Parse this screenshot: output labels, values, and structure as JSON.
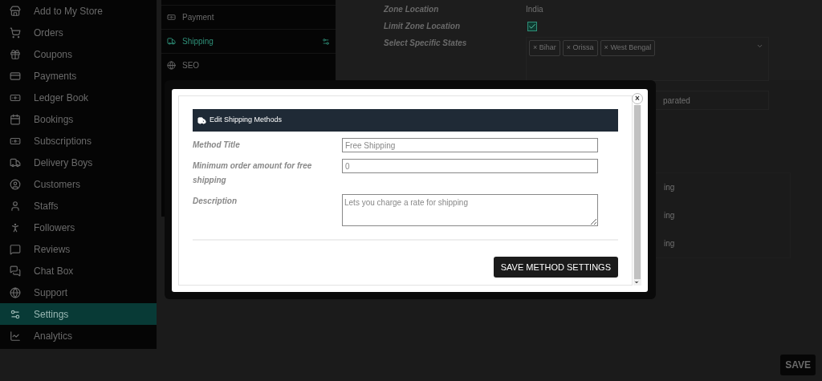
{
  "sidebar": {
    "items": [
      {
        "label": "Add to My Store",
        "selected": false
      },
      {
        "label": "Orders",
        "selected": false
      },
      {
        "label": "Coupons",
        "selected": false
      },
      {
        "label": "Payments",
        "selected": false
      },
      {
        "label": "Ledger Book",
        "selected": false
      },
      {
        "label": "Bookings",
        "selected": false
      },
      {
        "label": "Subscriptions",
        "selected": false
      },
      {
        "label": "Delivery Boys",
        "selected": false
      },
      {
        "label": "Customers",
        "selected": false
      },
      {
        "label": "Staffs",
        "selected": false
      },
      {
        "label": "Followers",
        "selected": false
      },
      {
        "label": "Reviews",
        "selected": false
      },
      {
        "label": "Chat Box",
        "selected": false
      },
      {
        "label": "Support",
        "selected": false
      },
      {
        "label": "Settings",
        "selected": true
      },
      {
        "label": "Analytics",
        "selected": false
      }
    ]
  },
  "settings_menu": {
    "items": [
      {
        "label": "Payment",
        "selected": false
      },
      {
        "label": "Shipping",
        "selected": true
      },
      {
        "label": "SEO",
        "selected": false
      }
    ]
  },
  "zone": {
    "location_label": "Zone Location",
    "location_value": "India",
    "limit_label": "Limit Zone Location",
    "limit_checked": true,
    "states_label": "Select Specific States",
    "states": [
      "Bihar",
      "Orissa",
      "West Bengal"
    ],
    "tag_remove": "×",
    "postcode_fragment": "parated",
    "table_fragments": [
      "ing",
      "ing",
      "ing"
    ]
  },
  "footer": {
    "save": "SAVE"
  },
  "modal": {
    "title": "Edit Shipping Methods",
    "fields": [
      {
        "kind": "input",
        "label": "Method Title",
        "placeholder": "Free Shipping"
      },
      {
        "kind": "input",
        "label": "Minimum order amount for free shipping",
        "placeholder": "0"
      },
      {
        "kind": "textarea",
        "label": "Description",
        "placeholder": "Lets you charge a rate for shipping"
      }
    ],
    "save": "SAVE METHOD SETTINGS",
    "close": "×"
  }
}
